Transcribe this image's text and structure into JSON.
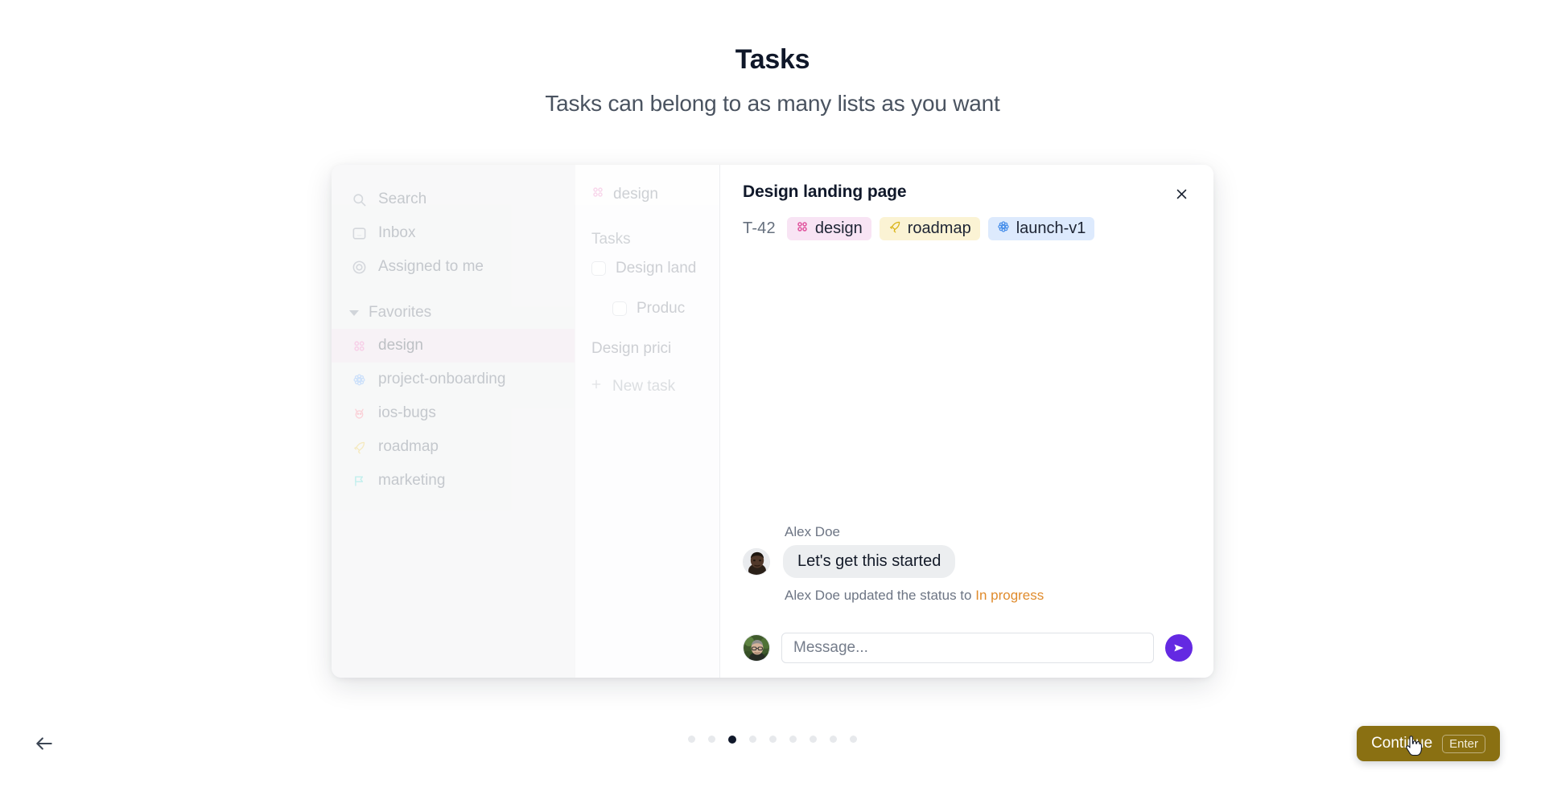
{
  "header": {
    "title": "Tasks",
    "subtitle": "Tasks can belong to as many lists as you want"
  },
  "sidebar": {
    "nav": [
      {
        "label": "Search",
        "icon": "search-icon"
      },
      {
        "label": "Inbox",
        "icon": "inbox-icon"
      },
      {
        "label": "Assigned to me",
        "icon": "target-icon"
      }
    ],
    "group_label": "Favorites",
    "lists": [
      {
        "label": "design",
        "icon": "four-dots-icon",
        "color": "#e879bd",
        "selected": true
      },
      {
        "label": "project-onboarding",
        "icon": "flower-icon",
        "color": "#6ea8f2",
        "selected": false
      },
      {
        "label": "ios-bugs",
        "icon": "bug-icon",
        "color": "#f3798c",
        "selected": false
      },
      {
        "label": "roadmap",
        "icon": "rocket-icon",
        "color": "#e3c24a",
        "selected": false
      },
      {
        "label": "marketing",
        "icon": "flag-icon",
        "color": "#4fd3cd",
        "selected": false
      }
    ]
  },
  "list_column": {
    "list_name": "design",
    "section_label": "Tasks",
    "tasks": [
      {
        "label": "Design land",
        "sub": false
      },
      {
        "label": "Produc",
        "sub": true
      },
      {
        "label": "Design prici",
        "sub": false,
        "no_checkbox": true
      }
    ],
    "new_task_label": "New task",
    "new_task_icon": "plus-icon"
  },
  "detail": {
    "title": "Design landing page",
    "close_icon": "close-icon",
    "task_id": "T-42",
    "tags": [
      {
        "label": "design",
        "icon": "four-dots-icon",
        "style": "design"
      },
      {
        "label": "roadmap",
        "icon": "rocket-icon",
        "style": "roadmap"
      },
      {
        "label": "launch-v1",
        "icon": "flower-icon",
        "style": "launch"
      }
    ],
    "thread": {
      "author": "Alex Doe",
      "message": "Let's get this started",
      "status_prefix": "Alex Doe updated the status to ",
      "status_value": "In progress",
      "status_color": "#e08b2c"
    },
    "composer": {
      "placeholder": "Message...",
      "value": "",
      "send_icon": "send-icon"
    }
  },
  "footer": {
    "back_icon": "arrow-left-icon",
    "dots_total": 9,
    "dot_active_index": 3,
    "continue_label": "Continue",
    "continue_key": "Enter",
    "continue_color": "#8a7012"
  }
}
